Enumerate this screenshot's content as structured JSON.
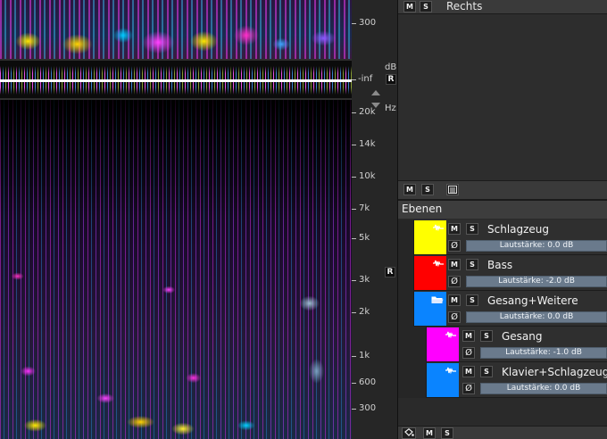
{
  "ruler": {
    "top_label": "300",
    "db_unit": "dB",
    "inf_label": "-inf",
    "hz_unit": "Hz",
    "r_badge": "R",
    "labels": [
      "20k",
      "14k",
      "10k",
      "7k",
      "5k",
      "3k",
      "2k",
      "1k",
      "600",
      "300"
    ]
  },
  "right_panel": {
    "channel_label": "Rechts",
    "m_label": "M",
    "s_label": "S"
  },
  "layers_panel": {
    "title": "Ebenen",
    "phase_symbol": "Ø",
    "layers": [
      {
        "name": "Schlagzeug",
        "volume": "Lautstärke: 0.0 dB",
        "color": "#ffff00"
      },
      {
        "name": "Bass",
        "volume": "Lautstärke: -2.0 dB",
        "color": "#ff0000"
      },
      {
        "name": "Gesang+Weitere",
        "volume": "Lautstärke: 0.0 dB",
        "color": "#0a84ff"
      },
      {
        "name": "Gesang",
        "volume": "Lautstärke: -1.0 dB",
        "color": "#ff00ff"
      },
      {
        "name": "Klavier+Schlagzeug+B",
        "volume": "Lautstärke: 0.0 dB",
        "color": "#0a84ff"
      }
    ]
  }
}
